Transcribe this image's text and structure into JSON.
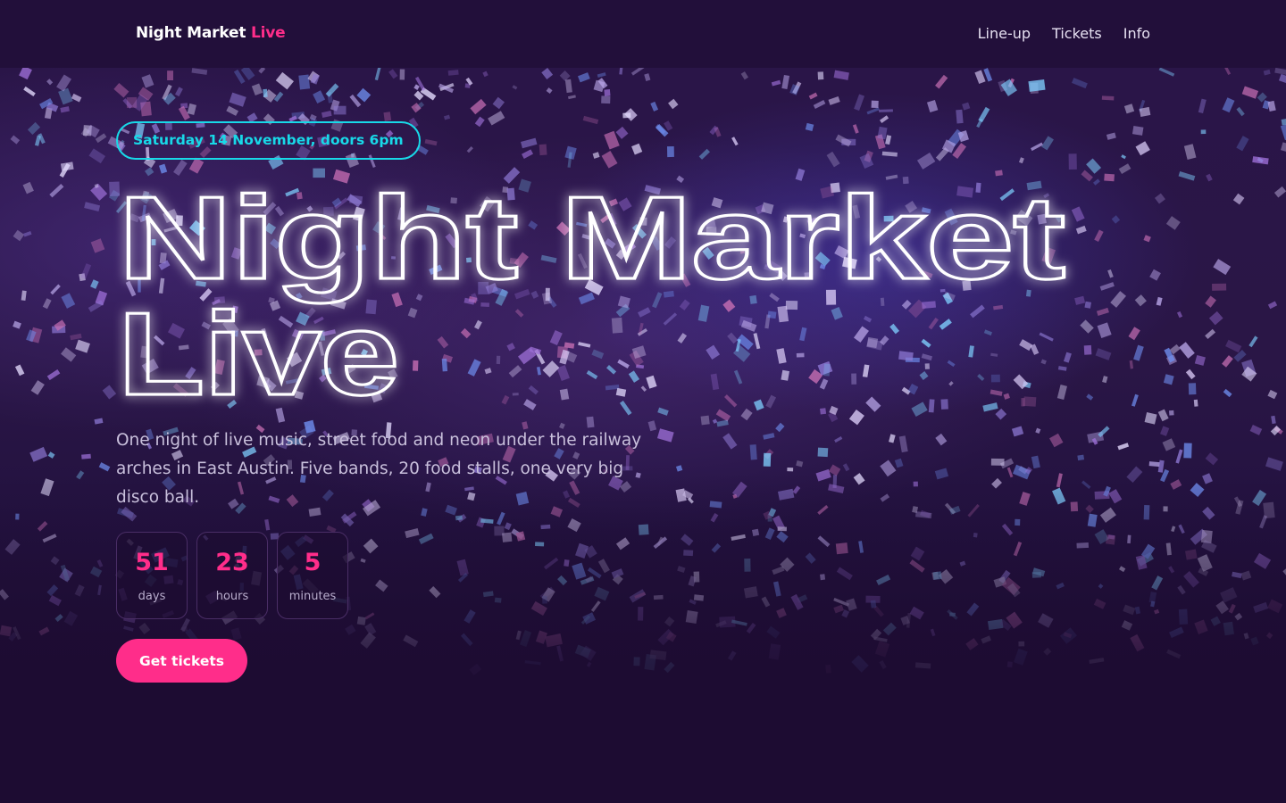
{
  "brand": {
    "name": "Night Market",
    "accent": "Live"
  },
  "nav": {
    "links": [
      "Line-up",
      "Tickets",
      "Info"
    ]
  },
  "hero": {
    "date": "Saturday 14 November, doors 6pm",
    "title_line1": "Night Market",
    "title_line2": "Live",
    "description": "One night of live music, street food and neon under the railway arches in East Austin. Five bands, 20 food stalls, one very big disco ball.",
    "countdown": [
      {
        "value": "51",
        "label": "days"
      },
      {
        "value": "23",
        "label": "hours"
      },
      {
        "value": "5",
        "label": "minutes"
      }
    ],
    "cta_label": "Get tickets"
  },
  "colors": {
    "background": "#1d0c32",
    "nav_background": "#220f3a",
    "accent_pink": "#ff2d8a",
    "accent_cyan": "#18d9e8",
    "text_muted": "#c9c0dc"
  },
  "icons": [
    "confetti-background"
  ]
}
